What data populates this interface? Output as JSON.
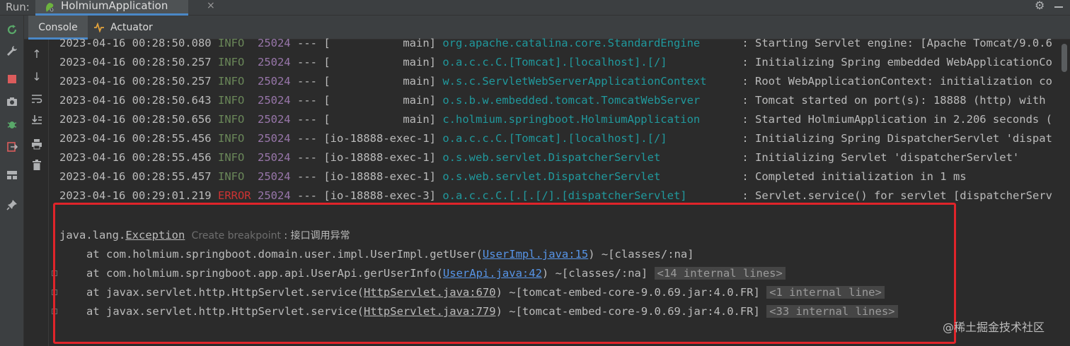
{
  "runbar": {
    "label": "Run:",
    "tab_title": "HolmiumApplication",
    "close": "×",
    "settings_icon": "gear-icon",
    "minimize_icon": "minimize-icon"
  },
  "tabs": {
    "console": "Console",
    "actuator": "Actuator"
  },
  "log_lines": [
    {
      "date": "2023-04-16 00:28:50.080",
      "level": "INFO",
      "pid": "25024",
      "sep": "---",
      "thread": "[           main]",
      "logger": "org.apache.catalina.core.StandardEngine",
      "msg": ": Starting Servlet engine: [Apache Tomcat/9.0.6"
    },
    {
      "date": "2023-04-16 00:28:50.257",
      "level": "INFO",
      "pid": "25024",
      "sep": "---",
      "thread": "[           main]",
      "logger": "o.a.c.c.C.[Tomcat].[localhost].[/]",
      "msg": ": Initializing Spring embedded WebApplicationCo"
    },
    {
      "date": "2023-04-16 00:28:50.257",
      "level": "INFO",
      "pid": "25024",
      "sep": "---",
      "thread": "[           main]",
      "logger": "w.s.c.ServletWebServerApplicationContext",
      "msg": ": Root WebApplicationContext: initialization co"
    },
    {
      "date": "2023-04-16 00:28:50.643",
      "level": "INFO",
      "pid": "25024",
      "sep": "---",
      "thread": "[           main]",
      "logger": "o.s.b.w.embedded.tomcat.TomcatWebServer",
      "msg": ": Tomcat started on port(s): 18888 (http) with"
    },
    {
      "date": "2023-04-16 00:28:50.656",
      "level": "INFO",
      "pid": "25024",
      "sep": "---",
      "thread": "[           main]",
      "logger": "c.holmium.springboot.HolmiumApplication",
      "msg": ": Started HolmiumApplication in 2.206 seconds ("
    },
    {
      "date": "2023-04-16 00:28:55.456",
      "level": "INFO",
      "pid": "25024",
      "sep": "---",
      "thread": "[io-18888-exec-1]",
      "logger": "o.a.c.c.C.[Tomcat].[localhost].[/]",
      "msg": ": Initializing Spring DispatcherServlet 'dispat"
    },
    {
      "date": "2023-04-16 00:28:55.456",
      "level": "INFO",
      "pid": "25024",
      "sep": "---",
      "thread": "[io-18888-exec-1]",
      "logger": "o.s.web.servlet.DispatcherServlet",
      "msg": ": Initializing Servlet 'dispatcherServlet'"
    },
    {
      "date": "2023-04-16 00:28:55.457",
      "level": "INFO",
      "pid": "25024",
      "sep": "---",
      "thread": "[io-18888-exec-1]",
      "logger": "o.s.web.servlet.DispatcherServlet",
      "msg": ": Completed initialization in 1 ms"
    },
    {
      "date": "2023-04-16 00:29:01.219",
      "level": "ERROR",
      "pid": "25024",
      "sep": "---",
      "thread": "[io-18888-exec-3]",
      "logger": "o.a.c.c.C.[.[.[/].[dispatcherServlet]",
      "msg": ": Servlet.service() for servlet [dispatcherServ"
    }
  ],
  "exception": {
    "prefix": "java.lang.",
    "name": "Exception",
    "hint": "Create breakpoint",
    "message": " : 接口调用异常"
  },
  "stack": [
    {
      "at": "at com.holmium.springboot.domain.user.impl.UserImpl.getUser(",
      "link": "UserImpl.java:15",
      "after": ") ~[classes/:na]",
      "internal": ""
    },
    {
      "at": "at com.holmium.springboot.app.api.UserApi.gerUserInfo(",
      "link": "UserApi.java:42",
      "after": ") ~[classes/:na] ",
      "internal": "<14 internal lines>"
    },
    {
      "at": "at javax.servlet.http.HttpServlet.service(",
      "link": "HttpServlet.java:670",
      "after": ") ~[tomcat-embed-core-9.0.69.jar:4.0.FR] ",
      "internal": "<1 internal line>"
    },
    {
      "at": "at javax.servlet.http.HttpServlet.service(",
      "link": "HttpServlet.java:779",
      "after": ") ~[tomcat-embed-core-9.0.69.jar:4.0.FR] ",
      "internal": "<33 internal lines>"
    }
  ],
  "watermark": "@稀土掘金技术社区",
  "colors": {
    "info": "#6a8759",
    "error": "#cc3333",
    "pid": "#9876aa",
    "logger": "#20999d",
    "link": "#5795e8",
    "highlight_box": "#e0242a"
  }
}
